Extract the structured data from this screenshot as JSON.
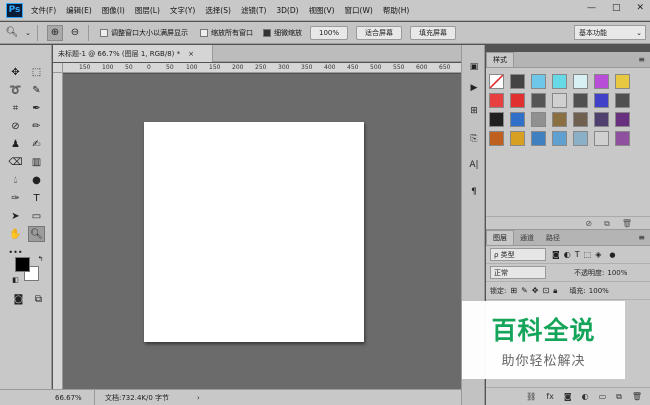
{
  "menubar": {
    "logo": "Ps",
    "items": [
      "文件(F)",
      "编辑(E)",
      "图像(I)",
      "图层(L)",
      "文字(Y)",
      "选择(S)",
      "滤镜(T)",
      "3D(D)",
      "视图(V)",
      "窗口(W)",
      "帮助(H)"
    ],
    "window_controls": [
      "—",
      "□",
      "✕"
    ]
  },
  "options_bar": {
    "resize_windows": "调整窗口大小以满屏显示",
    "zoom_all_windows": "缩放所有窗口",
    "scrubby_zoom": "细微缩放",
    "zoom_100": "100%",
    "fit_screen": "适合屏幕",
    "fill_screen": "填充屏幕",
    "workspace": "基本功能"
  },
  "document": {
    "tab_title": "未标题-1 @ 66.7% (图层 1, RGB/8) *",
    "tab_close": "×",
    "ruler_labels": [
      "150",
      "100",
      "50",
      "0",
      "50",
      "100",
      "150",
      "200",
      "250",
      "300",
      "350",
      "400",
      "450",
      "500",
      "550",
      "600",
      "650",
      "700",
      "750"
    ]
  },
  "status": {
    "zoom": "66.67%",
    "doc_info": "文档:732.4K/0 字节",
    "arrow": "›"
  },
  "styles_panel": {
    "tab": "样式",
    "menu": "≡",
    "swatches": [
      "#ffffff",
      "#444444",
      "#6ec6e8",
      "#66d8e6",
      "#d8f0f4",
      "#b84ed8",
      "#e8c840",
      "#e84040",
      "#e03030",
      "#555555",
      "#d0d0d0",
      "#505050",
      "#4040c8",
      "#505050",
      "#202020",
      "#3070c8",
      "#909090",
      "#8a7040",
      "#706050",
      "#504070",
      "#6a3080",
      "#c06020",
      "#d8a020",
      "#4080c0",
      "#60a0d0",
      "#8ab0c8",
      "#d0d0d0",
      "#9050a0"
    ]
  },
  "layers_panel": {
    "tabs": [
      "图层",
      "通道",
      "路径"
    ],
    "menu": "≡",
    "filter_label": "ρ 类型",
    "blend_mode": "正常",
    "opacity_label": "不透明度:",
    "opacity_value": "100%",
    "lock_label": "锁定:",
    "fill_label": "填充:",
    "fill_value": "100%"
  },
  "watermark": {
    "title": "百科全说",
    "subtitle": "助你轻松解决"
  }
}
